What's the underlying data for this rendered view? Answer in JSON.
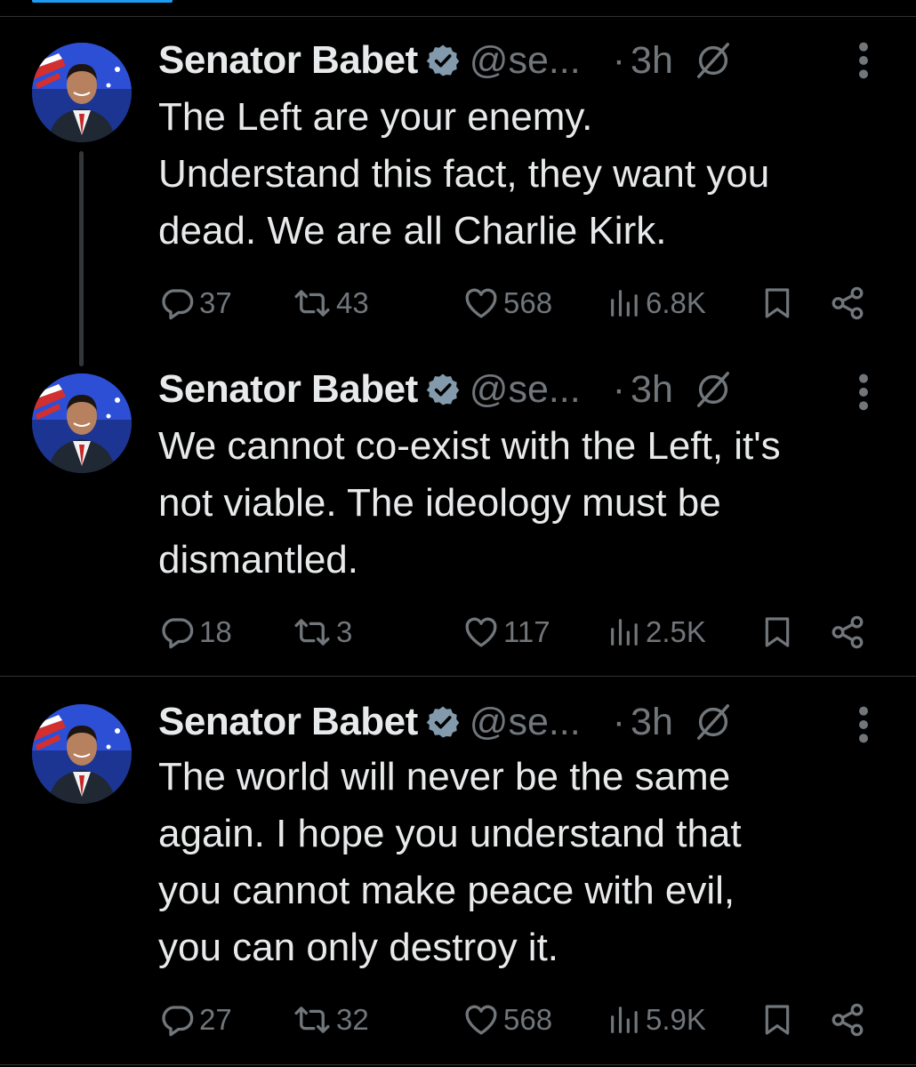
{
  "colors": {
    "background": "#000000",
    "text": "#e7e9ea",
    "muted": "#71767b",
    "verified": "#829aab",
    "accent": "#1d9bf0",
    "divider": "#2f3336"
  },
  "icons": {
    "verified": "verified-badge-icon",
    "grok": "grok-icon",
    "more": "more-vertical-icon",
    "reply": "reply-icon",
    "repost": "repost-icon",
    "like": "heart-icon",
    "views": "views-icon",
    "bookmark": "bookmark-icon",
    "share": "share-icon"
  },
  "tweets": [
    {
      "author": "Senator Babet",
      "handle": "@se...",
      "dot": "·",
      "time": "3h",
      "lines": [
        "The Left are your enemy.",
        "Understand this fact, they want you",
        "dead. We are all Charlie Kirk."
      ],
      "replies": "37",
      "reposts": "43",
      "likes": "568",
      "views": "6.8K"
    },
    {
      "author": "Senator Babet",
      "handle": "@se...",
      "dot": "·",
      "time": "3h",
      "lines": [
        "We cannot co-exist with the Left, it's",
        "not viable. The ideology must be",
        "dismantled."
      ],
      "replies": "18",
      "reposts": "3",
      "likes": "117",
      "views": "2.5K"
    },
    {
      "author": "Senator Babet",
      "handle": "@se...",
      "dot": "·",
      "time": "3h",
      "lines": [
        "The world will never be the same",
        "again. I hope you understand that",
        "you cannot make peace with evil,",
        "you can only destroy it."
      ],
      "replies": "27",
      "reposts": "32",
      "likes": "568",
      "views": "5.9K"
    }
  ]
}
